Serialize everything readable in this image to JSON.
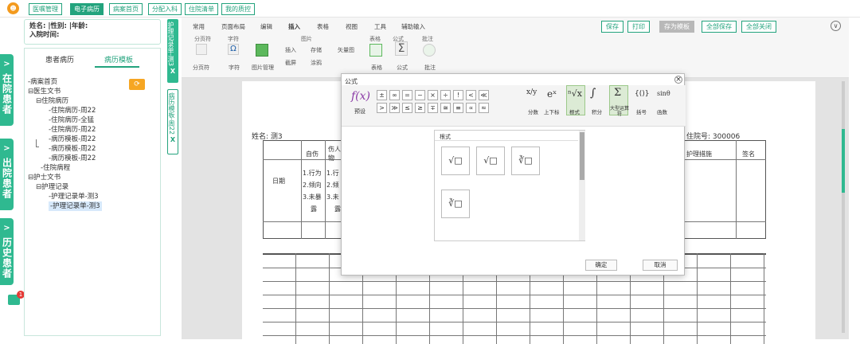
{
  "nav": {
    "user_icon": "user-avatar-icon",
    "buttons": [
      "医嘱管理",
      "电子病历",
      "病案首页",
      "分配入科",
      "住院清单",
      "我的质控"
    ]
  },
  "side_tabs": [
    "在院患者",
    "出院患者",
    "历史患者"
  ],
  "side_chevron": ">",
  "badge": "1",
  "patient": {
    "line1": "姓名:   |性别:   |年龄:",
    "line2": "入院时间:"
  },
  "left_tabs": [
    "患者病历",
    "病历模板"
  ],
  "tree": [
    "-病案首页",
    "⊟医生文书",
    "⊟住院病历",
    "-住院病历-周22",
    "-住院病历-全猛",
    "-住院病历-周22",
    "-病历模板-周22",
    "-病历模板-周22",
    "-病历模板-周22",
    "-住院病程",
    "⊟护士文书",
    "⊟护理记录",
    "-护理记录单-测3",
    "-护理记录单-测3"
  ],
  "vtabs": [
    "护理记录单-测3",
    "病历模板-周22"
  ],
  "vtab_close": "X",
  "ribbon": {
    "tabs": [
      "常用",
      "页面布局",
      "编辑",
      "插入",
      "表格",
      "视图",
      "工具",
      "辅助输入"
    ],
    "groups": [
      "分页符",
      "字符",
      "图片",
      "表格",
      "公式",
      "批注"
    ],
    "items": [
      "分页符",
      "字符",
      "图片管理",
      "插入",
      "存储",
      "矢量图",
      "截屏",
      "涂鸦",
      "表格",
      "公式",
      "批注"
    ],
    "omega": "Ω",
    "sigma": "Σ"
  },
  "top_buttons": [
    "保存",
    "打印",
    "存为模板",
    "全部保存",
    "全部关闭"
  ],
  "doc": {
    "name_label": "姓名: 测3",
    "hosp_no": "住院号: 300006",
    "headers": [
      "日期",
      "自伤",
      "伤人物",
      "护理措施",
      "签名"
    ],
    "col1": [
      "1.行为",
      "2.倾向",
      "3.未暴",
      "露"
    ],
    "col2": [
      "1.行",
      "2.倾",
      "3.未",
      "露"
    ]
  },
  "dialog": {
    "title": "公式",
    "close": "×",
    "preset_label": "预设",
    "fx": "f(x)",
    "symbols": [
      "±",
      "∞",
      "=",
      "~",
      "×",
      "÷",
      "!",
      "<",
      "≪",
      ">",
      "≫",
      "≤",
      "≥",
      "∓",
      "≅",
      "≡",
      "∝",
      "≈"
    ],
    "categories": [
      "分数",
      "上下标",
      "根式",
      "积分",
      "大型运算符",
      "括号",
      "函数"
    ],
    "cat_symbols": [
      "x/y",
      "eˣ",
      "ⁿ√x",
      "∫",
      "Σ",
      "{()}",
      "sinθ"
    ],
    "section_title": "根式",
    "templates": [
      "√□",
      "√□",
      "∛□",
      "∛□"
    ],
    "ok": "确定",
    "cancel": "取消"
  }
}
